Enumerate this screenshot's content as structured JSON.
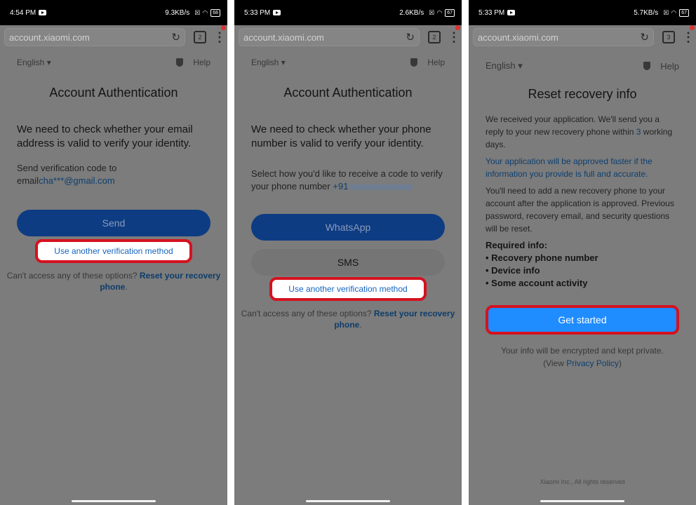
{
  "screens": [
    {
      "status": {
        "time": "4:54 PM",
        "net": "9.3KB/s",
        "battery": "68"
      },
      "browser": {
        "url": "account.xiaomi.com",
        "tab_count": "2"
      },
      "lang": "English",
      "help": "Help",
      "title": "Account Authentication",
      "message": "We need to check whether your email address is valid to verify your identity.",
      "send_to_label": "Send verification code to",
      "email_prefix": "email",
      "email_value": "cha***@gmail.com",
      "primary_button": "Send",
      "alt_method": "Use another verification method",
      "cant_access": "Can't access any of these options?",
      "reset_link": "Reset your recovery phone",
      "reset_end": "."
    },
    {
      "status": {
        "time": "5:33 PM",
        "net": "2.6KB/s",
        "battery": "67"
      },
      "browser": {
        "url": "account.xiaomi.com",
        "tab_count": "2"
      },
      "lang": "English",
      "help": "Help",
      "title": "Account Authentication",
      "message": "We need to check whether your phone number is valid to verify your identity.",
      "select_label": "Select how you'd like to receive a code to verify your phone number",
      "phone_prefix": "+91",
      "primary_button": "WhatsApp",
      "secondary_button": "SMS",
      "alt_method": "Use another verification method",
      "cant_access": "Can't access any of these options?",
      "reset_link": "Reset your recovery phone",
      "reset_end": "."
    },
    {
      "status": {
        "time": "5:33 PM",
        "net": "5.7KB/s",
        "battery": "67"
      },
      "browser": {
        "url": "account.xiaomi.com",
        "tab_count": "3"
      },
      "lang": "English",
      "help": "Help",
      "title": "Reset recovery info",
      "p1_start": "We received your application. We'll send you a reply to your new recovery phone within ",
      "p1_days_num": "3",
      "p1_end": " working days.",
      "p2": "Your application will be approved faster if the information you provide is full and accurate.",
      "p3": "You'll need to add a new recovery phone to your account after the application is approved. Previous password, recovery email, and security questions will be reset.",
      "required_title": "Required info:",
      "required": [
        "Recovery phone number",
        "Device info",
        "Some account activity"
      ],
      "cta": "Get started",
      "privacy_text": "Your info will be encrypted and kept private.",
      "privacy_open": "(View ",
      "privacy_link": "Privacy Policy",
      "privacy_close": ")",
      "copyright": "Xiaomi Inc., All rights reserved"
    }
  ],
  "colors": {
    "accent_red": "#d4121f",
    "cta_blue": "#1f8cff",
    "link_blue": "#1565c0"
  }
}
